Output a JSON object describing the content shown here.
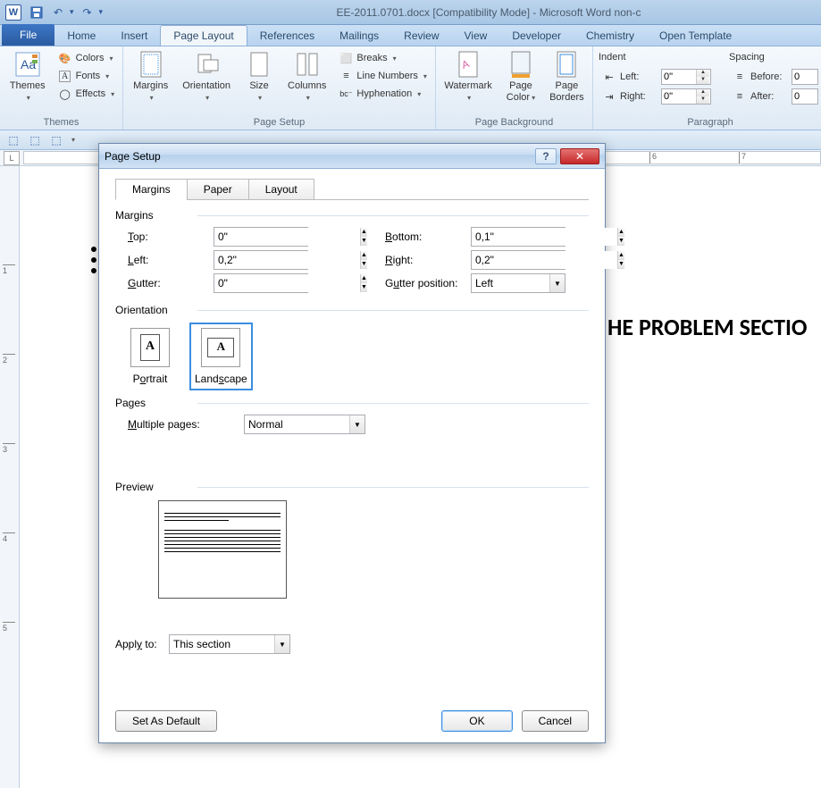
{
  "titlebar": {
    "app_title": "EE-2011.0701.docx [Compatibility Mode] - Microsoft Word non-c"
  },
  "tabs": {
    "file": "File",
    "list": [
      "Home",
      "Insert",
      "Page Layout",
      "References",
      "Mailings",
      "Review",
      "View",
      "Developer",
      "Chemistry",
      "Open Template"
    ],
    "active": "Page Layout"
  },
  "ribbon": {
    "themes": {
      "group_label": "Themes",
      "themes": "Themes",
      "colors": "Colors",
      "fonts": "Fonts",
      "effects": "Effects"
    },
    "pagesetup": {
      "group_label": "Page Setup",
      "margins": "Margins",
      "orientation": "Orientation",
      "size": "Size",
      "columns": "Columns",
      "breaks": "Breaks",
      "line_numbers": "Line Numbers",
      "hyphenation": "Hyphenation"
    },
    "background": {
      "group_label": "Page Background",
      "watermark": "Watermark",
      "page_color": "Page Color",
      "page_borders": "Page Borders"
    },
    "paragraph": {
      "group_label": "Paragraph",
      "indent_header": "Indent",
      "spacing_header": "Spacing",
      "left_label": "Left:",
      "right_label": "Right:",
      "before_label": "Before:",
      "after_label": "After:",
      "left": "0\"",
      "right": "0\"",
      "before": "0",
      "after": "0"
    }
  },
  "document": {
    "heading": "HE PROBLEM SECTIO"
  },
  "ruler": {
    "ticks": [
      "6",
      "7"
    ]
  },
  "dialog": {
    "title": "Page Setup",
    "tabs": {
      "margins": "Margins",
      "paper": "Paper",
      "layout": "Layout"
    },
    "sections": {
      "margins": "Margins",
      "orientation": "Orientation",
      "pages": "Pages",
      "preview": "Preview"
    },
    "margins": {
      "top_label": "Top:",
      "bottom_label": "Bottom:",
      "left_label": "Left:",
      "right_label": "Right:",
      "gutter_label": "Gutter:",
      "gutter_pos_label": "Gutter position:",
      "top": "0\"",
      "bottom": "0,1\"",
      "left": "0,2\"",
      "right": "0,2\"",
      "gutter": "0\"",
      "gutter_pos": "Left"
    },
    "orientation": {
      "portrait": "Portrait",
      "landscape": "Landscape"
    },
    "pages": {
      "multiple_label": "Multiple pages:",
      "multiple": "Normal"
    },
    "apply": {
      "label": "Apply to:",
      "value": "This section"
    },
    "buttons": {
      "set_default": "Set As Default",
      "ok": "OK",
      "cancel": "Cancel"
    }
  }
}
